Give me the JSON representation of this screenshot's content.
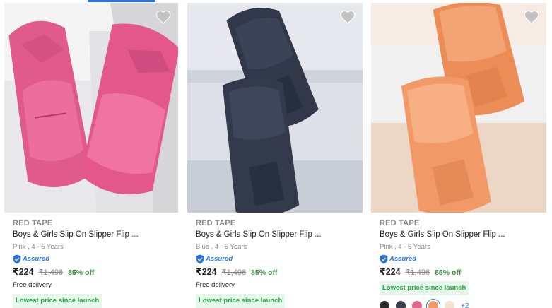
{
  "products": [
    {
      "brand": "RED TAPE",
      "title": "Boys & Girls Slip On Slipper Flip ...",
      "variant": "Pink , 4 - 5 Years",
      "assured_label": "Assured",
      "price": "₹224",
      "mrp": "₹1,496",
      "discount": "85% off",
      "delivery": "Free delivery",
      "badge": "Lowest price since launch",
      "icon": "heart-icon",
      "colors": {
        "bg": "#e4e4e6",
        "product": "#e15a8c"
      }
    },
    {
      "brand": "RED TAPE",
      "title": "Boys & Girls Slip On Slipper Flip ...",
      "variant": "Blue , 4 - 5 Years",
      "assured_label": "Assured",
      "price": "₹224",
      "mrp": "₹1,496",
      "discount": "85% off",
      "delivery": "Free delivery",
      "badge": "Lowest price since launch",
      "icon": "heart-icon",
      "colors": {
        "bg": "#d9dde3",
        "product": "#323a4c"
      }
    },
    {
      "brand": "RED TAPE",
      "title": "Boys & Girls Slip On Slipper Flip ...",
      "variant": "Pink , 4 - 5 Years",
      "assured_label": "Assured",
      "price": "₹224",
      "mrp": "₹1,496",
      "discount": "85% off",
      "badge": "Lowest price since launch",
      "icon": "heart-icon",
      "colors": {
        "bg": "#eddccf",
        "product": "#f19a68"
      },
      "swatch_colors": [
        "#2b2b2b",
        "#3a3f4e",
        "#e26690",
        "#f19a68",
        "#f4e3d3"
      ],
      "more_colors": "+2"
    }
  ],
  "theme": {
    "accent": "#2874f0",
    "discount": "#388e3c",
    "badge_bg": "#e6f8ec",
    "badge_text": "#26a541",
    "muted": "#878787"
  }
}
